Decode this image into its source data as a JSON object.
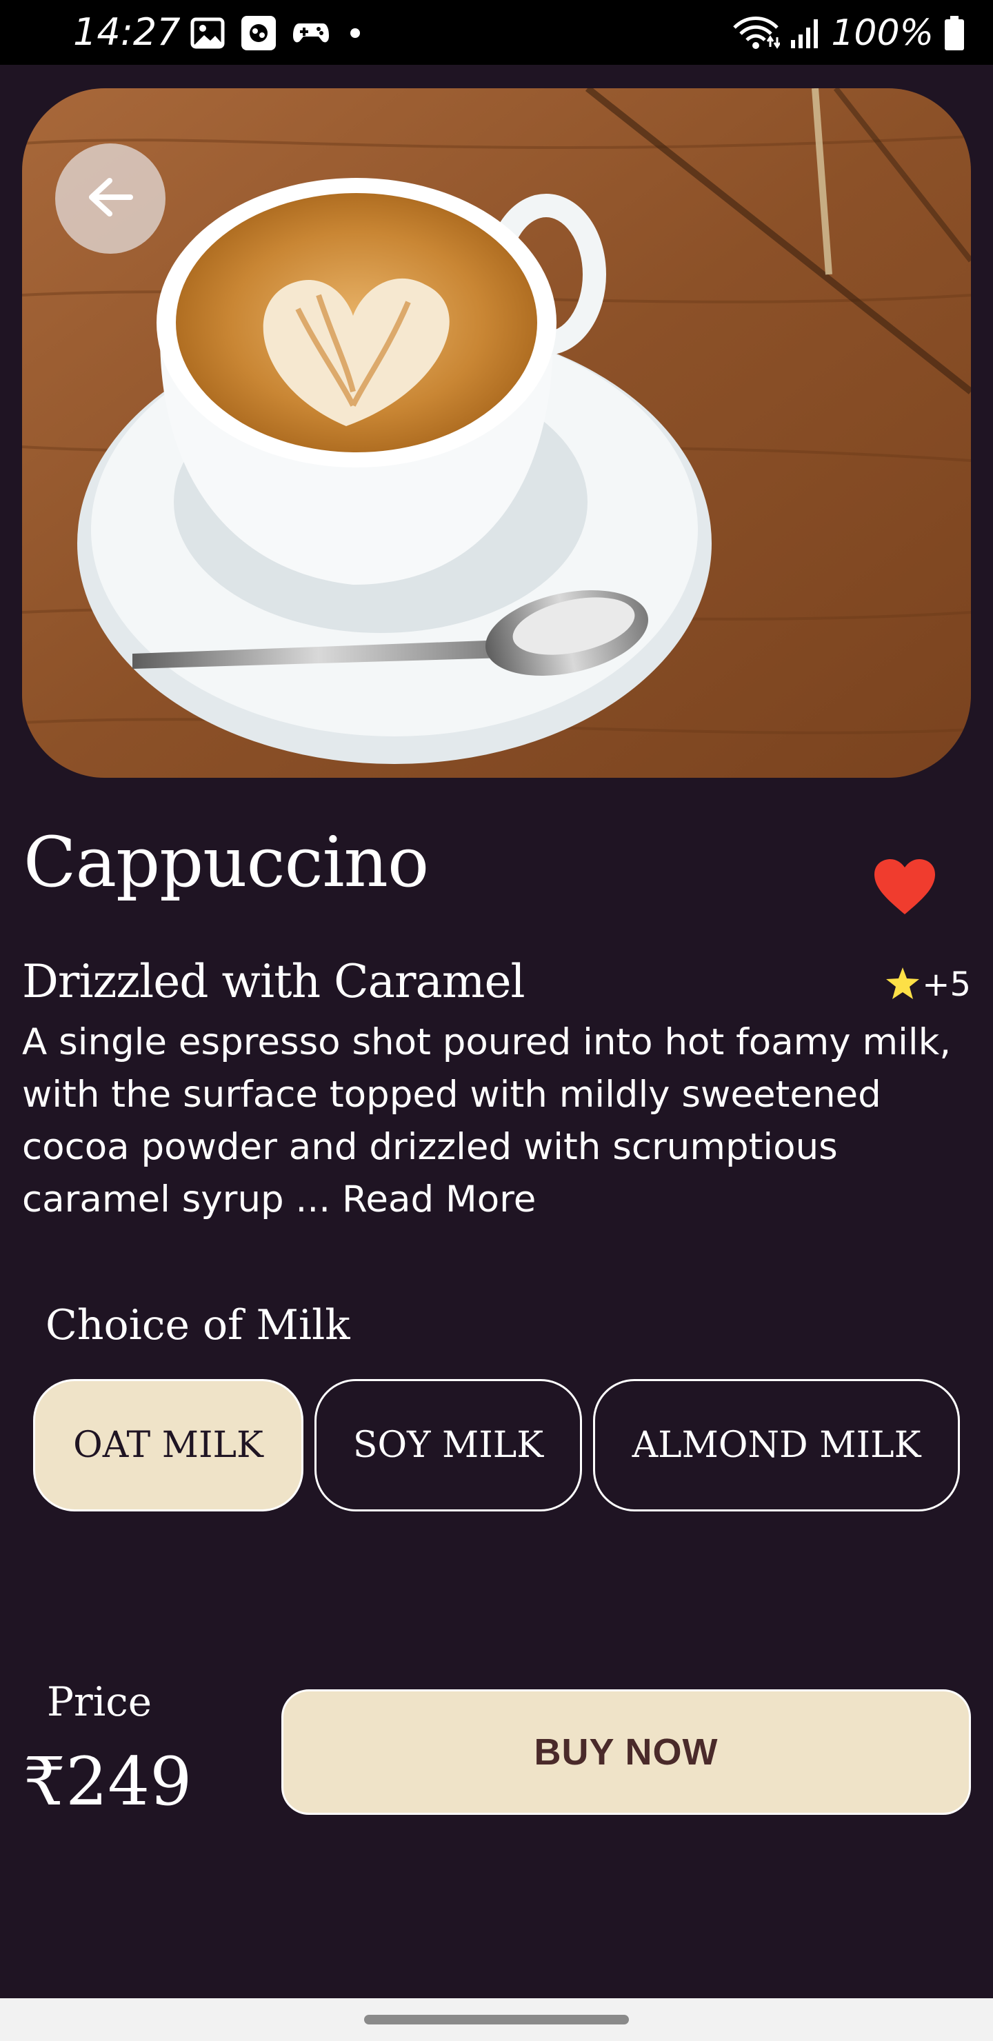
{
  "status_bar": {
    "time": "14:27",
    "battery": "100%",
    "left_icons": [
      "gallery-icon",
      "app-icon",
      "gamepad-icon",
      "dot-icon"
    ],
    "right_icons": [
      "wifi-icon",
      "signal-icon",
      "battery-icon"
    ]
  },
  "product": {
    "name": "Cappuccino",
    "subtitle": "Drizzled with Caramel",
    "rating_text": "+5",
    "description": "A single espresso shot poured into hot foamy milk, with the surface topped with mildly sweetened cocoa powder and drizzled with scrumptious caramel syrup ...",
    "read_more": "Read More",
    "favorite": true
  },
  "milk": {
    "label": "Choice of Milk",
    "options": [
      "OAT MILK",
      "SOY MILK",
      "ALMOND MILK"
    ],
    "selected": "OAT MILK"
  },
  "price": {
    "label": "Price",
    "value": "₹249"
  },
  "buy_button": "BUY NOW",
  "colors": {
    "background": "#1f1423",
    "accent": "#efe3c8",
    "favorite": "#f03c2e",
    "star": "#fde047"
  }
}
